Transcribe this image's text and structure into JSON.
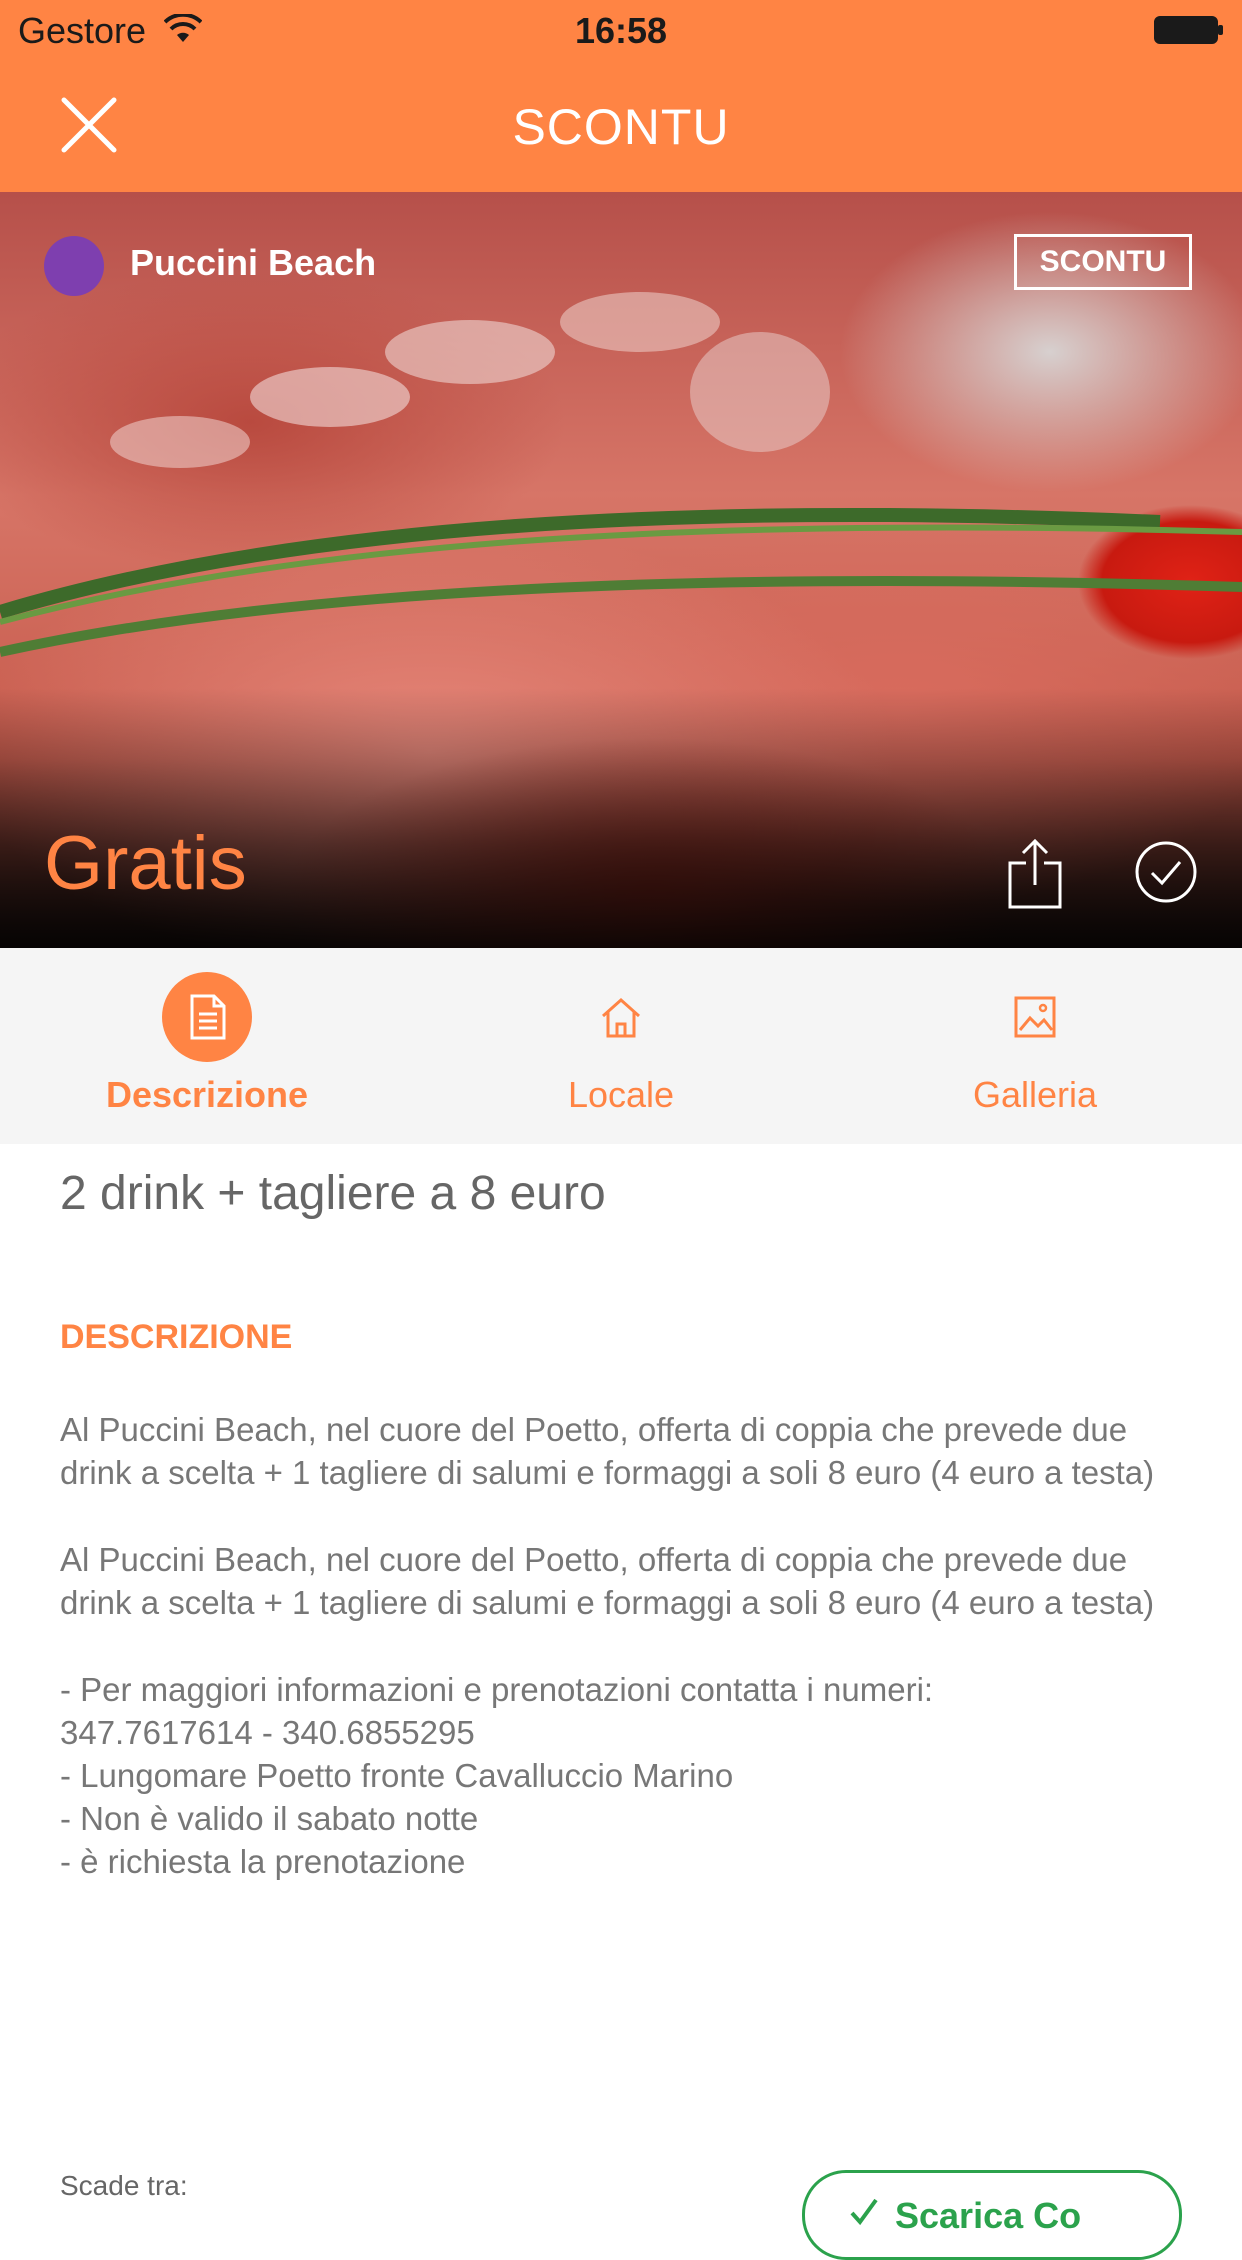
{
  "status_bar": {
    "carrier": "Gestore",
    "time": "16:58"
  },
  "nav": {
    "title": "SCONTU"
  },
  "hero": {
    "venue_name": "Puccini Beach",
    "venue_color": "#7E3FAF",
    "badge": "SCONTU",
    "price": "Gratis"
  },
  "tabs": [
    {
      "label": "Descrizione",
      "icon": "document-icon",
      "active": true
    },
    {
      "label": "Locale",
      "icon": "home-icon",
      "active": false
    },
    {
      "label": "Galleria",
      "icon": "image-icon",
      "active": false
    }
  ],
  "content": {
    "offer_title": "2 drink + tagliere a 8 euro",
    "section_heading": "DESCRIZIONE",
    "paragraphs": [
      "Al Puccini Beach, nel cuore del Poetto, offerta di coppia che prevede due drink a scelta + 1 tagliere di salumi e formaggi a soli 8 euro (4 euro a testa)",
      "Al Puccini Beach, nel cuore del Poetto, offerta di coppia che prevede due drink a scelta + 1 tagliere di salumi e formaggi a soli 8 euro (4 euro a testa)",
      "- Per maggiori informazioni e prenotazioni contatta i numeri:\n347.7617614 - 340.6855295\n- Lungomare Poetto fronte Cavalluccio Marino\n- Non è valido il sabato notte\n- è richiesta la prenotazione"
    ]
  },
  "footer": {
    "expires_label": "Scade tra:",
    "save_label": "Scarica Co"
  },
  "colors": {
    "accent": "#FF8444",
    "green": "#2BA24C"
  }
}
